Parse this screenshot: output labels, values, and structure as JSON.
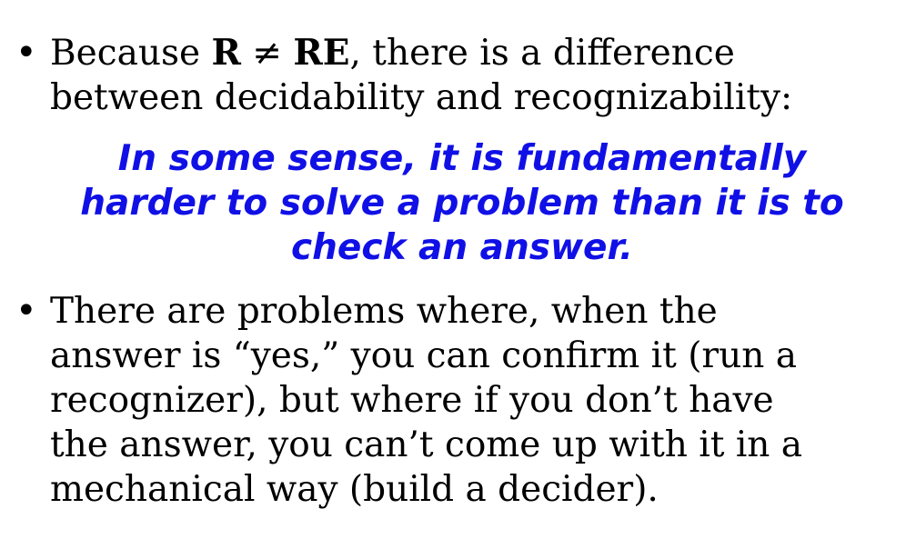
{
  "bullets": [
    {
      "marker": "•",
      "prefix": "Because ",
      "relation_left": "R",
      "relation_op": " ≠ ",
      "relation_right": "RE",
      "suffix": ", there is a difference",
      "line2": "between decidability and recognizability:"
    },
    {
      "marker": "•",
      "lines": [
        "There are problems where, when the",
        "answer is “yes,” you can confirm it (run a",
        "recognizer), but where if you don’t have",
        "the answer, you can’t come up with it in a",
        "mechanical way (build a decider)."
      ]
    }
  ],
  "emphasis": {
    "lines": [
      "In some sense, it is fundamentally",
      "harder to solve a problem than it is to",
      "check an answer."
    ],
    "color": "#1010e6"
  }
}
